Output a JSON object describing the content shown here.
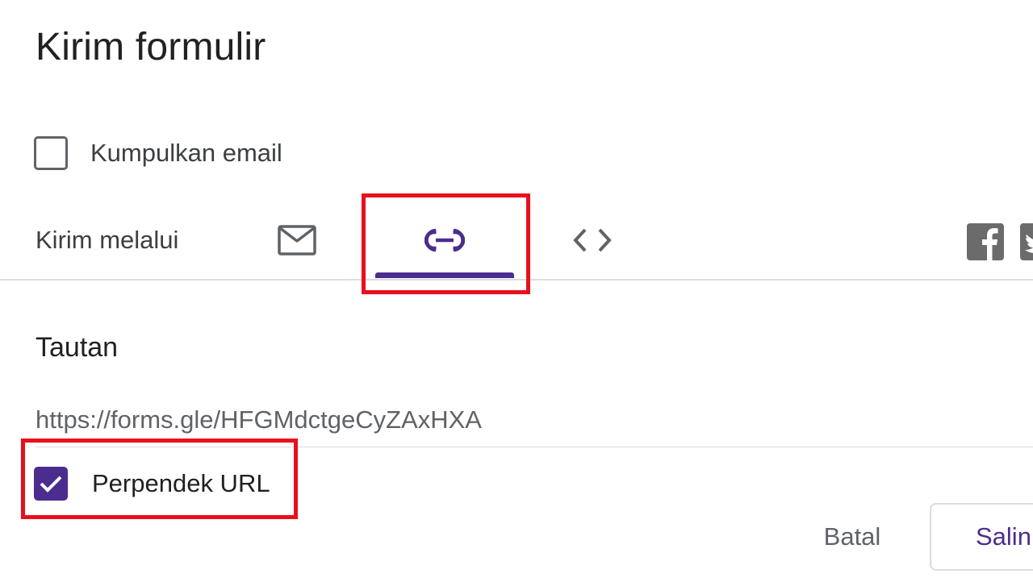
{
  "dialog": {
    "title": "Kirim formulir"
  },
  "collect_email": {
    "label": "Kumpulkan email",
    "checked": false
  },
  "send_via": {
    "label": "Kirim melalui",
    "tabs": [
      {
        "name": "email",
        "icon": "mail-icon",
        "selected": false
      },
      {
        "name": "link",
        "icon": "link-icon",
        "selected": true
      },
      {
        "name": "embed",
        "icon": "code-icon",
        "selected": false
      }
    ],
    "social": [
      {
        "name": "facebook",
        "icon": "facebook-icon"
      },
      {
        "name": "twitter",
        "icon": "twitter-icon"
      }
    ]
  },
  "link_section": {
    "title": "Tautan",
    "url": "https://forms.gle/HFGMdctgeCyZAxHXA",
    "shorten_label": "Perpendek URL",
    "shorten_checked": true
  },
  "actions": {
    "cancel_label": "Batal",
    "copy_label": "Salin"
  },
  "colors": {
    "accent": "#4b2d8f",
    "highlight": "#e8101c"
  }
}
